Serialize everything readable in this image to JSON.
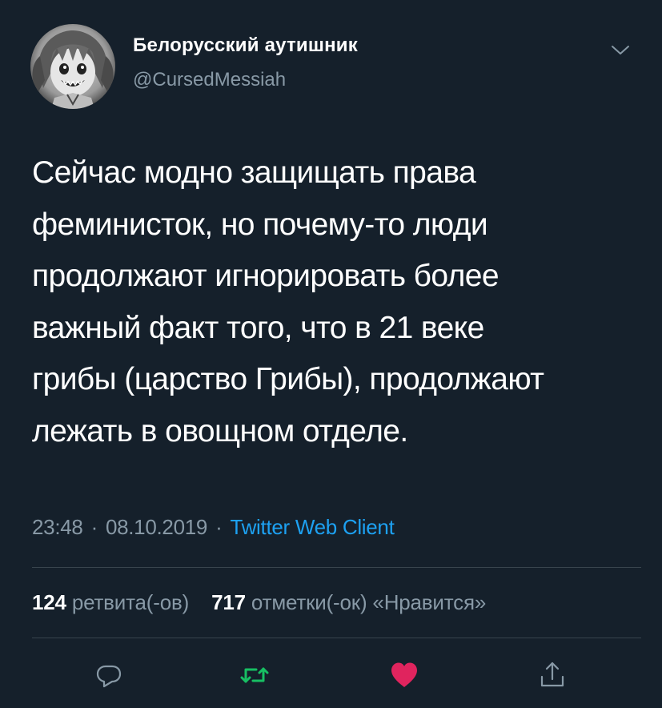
{
  "author": {
    "display_name": "Белорусский аутишник",
    "handle": "@CursedMessiah"
  },
  "tweet": {
    "text_lines": [
      "Сейчас модно защищать права",
      "феминисток, но почему-то люди",
      "продолжают игнорировать более",
      "важный факт того, что в 21 веке",
      "грибы (царство Грибы), продолжают",
      "лежать в овощном отделе."
    ],
    "time": "23:48",
    "date": "08.10.2019",
    "separator": "·",
    "client": "Twitter Web Client"
  },
  "stats": {
    "retweets_count": "124",
    "retweets_label": "ретвита(-ов)",
    "likes_count": "717",
    "likes_label": "отметки(-ок) «Нравится»"
  },
  "actions": [
    {
      "name": "reply",
      "icon": "reply-icon"
    },
    {
      "name": "retweet",
      "icon": "retweet-icon"
    },
    {
      "name": "like",
      "icon": "heart-icon"
    },
    {
      "name": "share",
      "icon": "share-icon"
    }
  ],
  "colors": {
    "background": "#15202b",
    "text_primary": "#ffffff",
    "text_secondary": "#8899a6",
    "link": "#1da1f2",
    "divider": "#38444d",
    "retweet_active": "#17bf63",
    "like_active": "#e0245e"
  }
}
